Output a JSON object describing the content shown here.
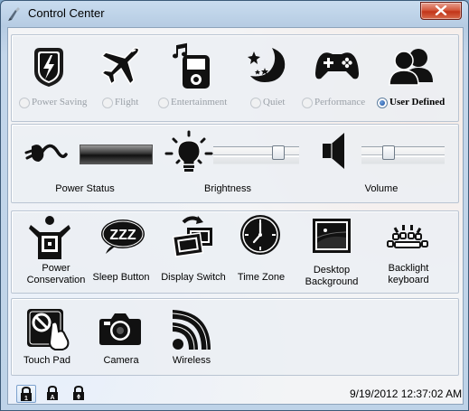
{
  "window": {
    "title": "Control Center",
    "app_icon": "control-center-icon",
    "close": "close-icon"
  },
  "power_modes": [
    {
      "label": "Power Saving",
      "icon": "power-saving-icon",
      "checked": false
    },
    {
      "label": "Flight",
      "icon": "airplane-icon",
      "checked": false
    },
    {
      "label": "Entertainment",
      "icon": "media-player-icon",
      "checked": false
    },
    {
      "label": "Quiet",
      "icon": "moon-stars-icon",
      "checked": false
    },
    {
      "label": "Performance",
      "icon": "gamepad-icon",
      "checked": false
    },
    {
      "label": "User Defined",
      "icon": "users-icon",
      "checked": true
    }
  ],
  "controls": {
    "power_status": {
      "label": "Power Status",
      "icon": "power-plug-icon"
    },
    "brightness": {
      "label": "Brightness",
      "icon": "light-bulb-icon",
      "level": 0.8
    },
    "volume": {
      "label": "Volume",
      "icon": "speaker-icon",
      "level": 0.3
    }
  },
  "functions": [
    {
      "line1": "Power",
      "line2": "Conservation",
      "icon": "power-conservation-icon"
    },
    {
      "line1": "Sleep Button",
      "line2": "",
      "icon": "sleep-zzz-icon"
    },
    {
      "line1": "Display Switch",
      "line2": "",
      "icon": "display-switch-icon"
    },
    {
      "line1": "Time Zone",
      "line2": "",
      "icon": "clock-icon"
    },
    {
      "line1": "Desktop",
      "line2": "Background",
      "icon": "desktop-background-icon"
    },
    {
      "line1": "Backlight",
      "line2": "keyboard",
      "icon": "keyboard-backlight-icon"
    }
  ],
  "devices": [
    {
      "label": "Touch Pad",
      "icon": "touchpad-disabled-icon"
    },
    {
      "label": "Camera",
      "icon": "camera-icon"
    },
    {
      "label": "Wireless",
      "icon": "wireless-icon"
    }
  ],
  "status": {
    "locks": [
      "num-lock-icon",
      "caps-lock-icon",
      "scroll-lock-icon"
    ],
    "datetime": "9/19/2012 12:37:02 AM"
  }
}
